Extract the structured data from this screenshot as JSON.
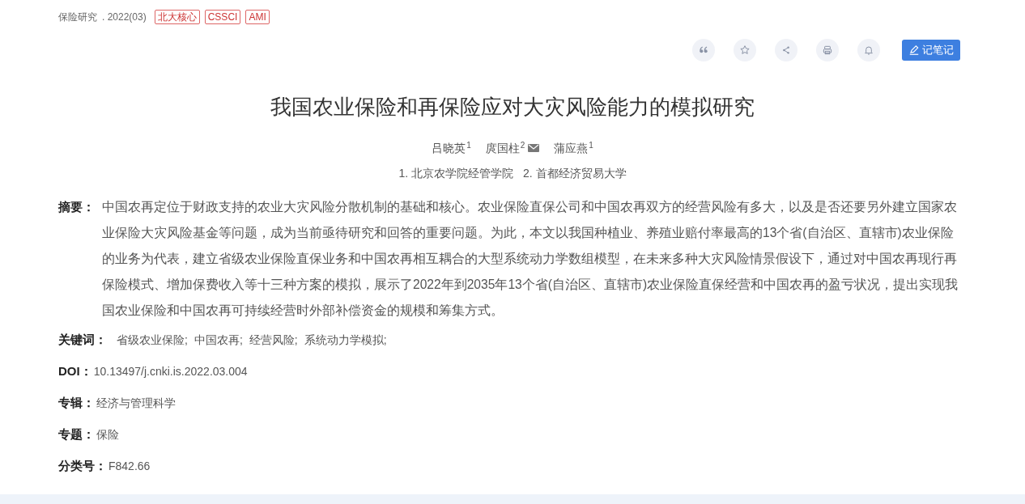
{
  "source": {
    "journal": "保险研究",
    "issue": ". 2022(03)",
    "tags": [
      "北大核心",
      "CSSCI",
      "AMI"
    ]
  },
  "toolbar": {
    "icons": [
      {
        "kind": "quote"
      },
      {
        "kind": "favorite"
      },
      {
        "kind": "share"
      },
      {
        "kind": "print"
      },
      {
        "kind": "alert"
      }
    ],
    "note_button": "记笔记"
  },
  "title": "我国农业保险和再保险应对大灾风险能力的模拟研究",
  "authors": [
    {
      "name": "吕晓英",
      "affiliation": "1",
      "corresponding": false
    },
    {
      "name": "庹国柱",
      "affiliation": "2",
      "corresponding": true
    },
    {
      "name": "蒲应燕",
      "affiliation": "1",
      "corresponding": false
    }
  ],
  "affiliations": [
    "1. 北京农学院经管学院",
    "2. 首都经济贸易大学"
  ],
  "abstract": {
    "label": "摘要：",
    "text": "中国农再定位于财政支持的农业大灾风险分散机制的基础和核心。农业保险直保公司和中国农再双方的经营风险有多大，以及是否还要另外建立国家农业保险大灾风险基金等问题，成为当前亟待研究和回答的重要问题。为此，本文以我国种植业、养殖业赔付率最高的13个省(自治区、直辖市)农业保险的业务为代表，建立省级农业保险直保业务和中国农再相互耦合的大型系统动力学数组模型，在未来多种大灾风险情景假设下，通过对中国农再现行再保险模式、增加保费收入等十三种方案的模拟，展示了2022年到2035年13个省(自治区、直辖市)农业保险直保经营和中国农再的盈亏状况，提出实现我国农业保险和中国农再可持续经营时外部补偿资金的规模和筹集方式。"
  },
  "keywords": {
    "label": "关键词：",
    "items": [
      "省级农业保险;",
      "中国农再;",
      "经营风险;",
      "系统动力学模拟;"
    ]
  },
  "fields": [
    {
      "label": "DOI：",
      "value": "10.13497/j.cnki.is.2022.03.004"
    },
    {
      "label": "专辑：",
      "value": "经济与管理科学"
    },
    {
      "label": "专题：",
      "value": "保险"
    },
    {
      "label": "分类号：",
      "value": "F842.66"
    }
  ]
}
